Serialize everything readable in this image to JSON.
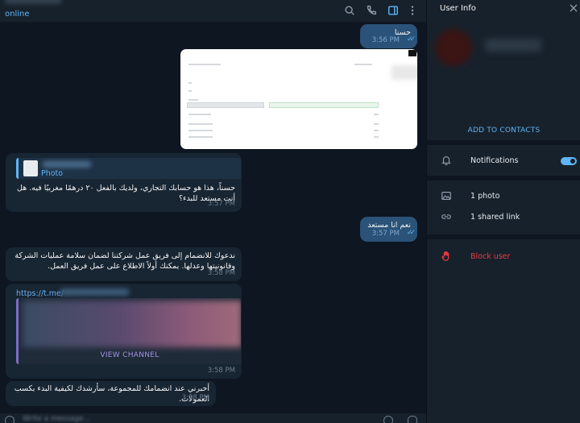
{
  "colors": {
    "accent": "#5eb5f7",
    "outgoing_bubble": "#2b5278",
    "incoming_bubble": "#182533",
    "danger": "#ec3942",
    "background": "#0e1621",
    "panel": "#17212b"
  },
  "chat": {
    "header": {
      "status": "online",
      "icons": [
        "search-icon",
        "phone-icon",
        "sidebar-toggle-icon",
        "more-vertical-icon"
      ]
    },
    "messages": [
      {
        "direction": "out",
        "text": "حسنا",
        "time": "3:56 PM",
        "read": true
      },
      {
        "direction": "in",
        "type": "photo"
      },
      {
        "direction": "in",
        "reply_label": "Photo",
        "text": "حسناً، هذا هو حسابك التجاري، ولديك بالفعل ٢٠ درهمًا مغربيًا فيه. هل أنت مستعد للبدء؟",
        "time": "3:57 PM"
      },
      {
        "direction": "out",
        "text": "نعم انا مستعد",
        "time": "3:57 PM",
        "read": true
      },
      {
        "direction": "in",
        "text": "ندعوك للانضمام إلى فريق عمل شركتنا لضمان سلامة عمليات الشركة وقانونيتها وعدلها. يمكنك أولاً الاطلاع على عمل فريق العمل.",
        "time": "3:58 PM"
      },
      {
        "direction": "in",
        "link": "https://t.me/",
        "button": "VIEW CHANNEL",
        "time": "3:58 PM"
      },
      {
        "direction": "in",
        "text": "أخبرني عند انضمامك للمجموعة، سأرشدك لكيفية البدء بكسب العمولات.",
        "time": "3:58 PM"
      }
    ],
    "composer": {
      "placeholder": "Write a message..."
    }
  },
  "sidebar": {
    "title": "User Info",
    "add_contacts": "ADD TO CONTACTS",
    "notifications": {
      "label": "Notifications",
      "enabled": true
    },
    "media": [
      {
        "icon": "photo-icon",
        "label": "1 photo"
      },
      {
        "icon": "link-icon",
        "label": "1 shared link"
      }
    ],
    "block": {
      "label": "Block user",
      "icon": "hand-stop-icon"
    }
  }
}
